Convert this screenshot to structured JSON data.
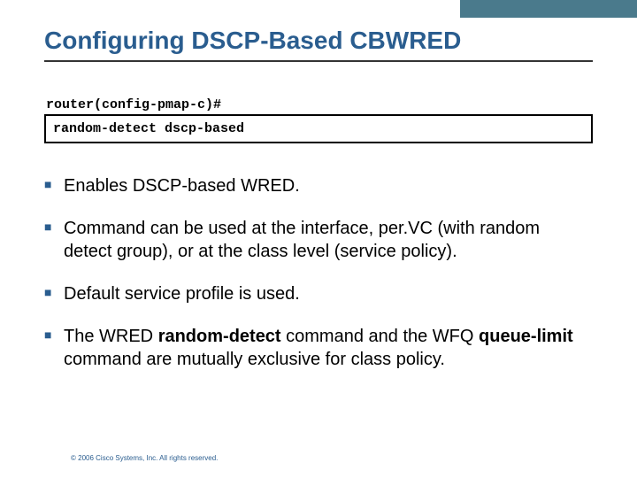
{
  "title": "Configuring DSCP-Based CBWRED",
  "prompt": "router(config-pmap-c)#",
  "command": "random-detect dscp-based",
  "bullets": [
    {
      "html": "Enables DSCP-based WRED."
    },
    {
      "html": "Command can be used at the interface, per.VC (with random detect group), or at the class level (service policy)."
    },
    {
      "html": "Default service profile is used."
    },
    {
      "html": "The WRED <b>random-detect</b> command and the WFQ <b>queue-limit</b> command are mutually exclusive for class policy."
    }
  ],
  "footer": "© 2006 Cisco Systems, Inc. All rights reserved."
}
